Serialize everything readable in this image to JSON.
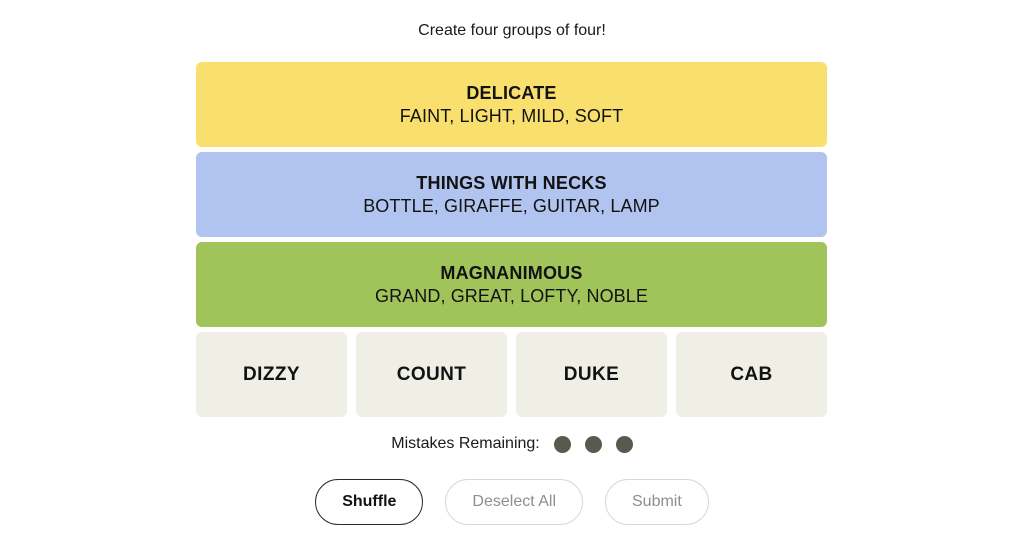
{
  "game": {
    "prompt": "Create four groups of four!"
  },
  "solved_groups": [
    {
      "title": "DELICATE",
      "members": "FAINT, LIGHT, MILD, SOFT",
      "color": "#f9df6d",
      "difficulty": "yellow"
    },
    {
      "title": "THINGS WITH NECKS",
      "members": "BOTTLE, GIRAFFE, GUITAR, LAMP",
      "color": "#b0c4ef",
      "difficulty": "blue"
    },
    {
      "title": "MAGNANIMOUS",
      "members": "GRAND, GREAT, LOFTY, NOBLE",
      "color": "#a0c35a",
      "difficulty": "green"
    }
  ],
  "remaining_tiles": [
    {
      "label": "DIZZY"
    },
    {
      "label": "COUNT"
    },
    {
      "label": "DUKE"
    },
    {
      "label": "CAB"
    }
  ],
  "mistakes": {
    "label": "Mistakes Remaining:",
    "remaining": 3,
    "dot_color": "#5a594e"
  },
  "buttons": [
    {
      "label": "Shuffle",
      "state": "enabled"
    },
    {
      "label": "Deselect All",
      "state": "disabled"
    },
    {
      "label": "Submit",
      "state": "disabled"
    }
  ],
  "tile_color": "#efefe6",
  "background": "#ffffff"
}
